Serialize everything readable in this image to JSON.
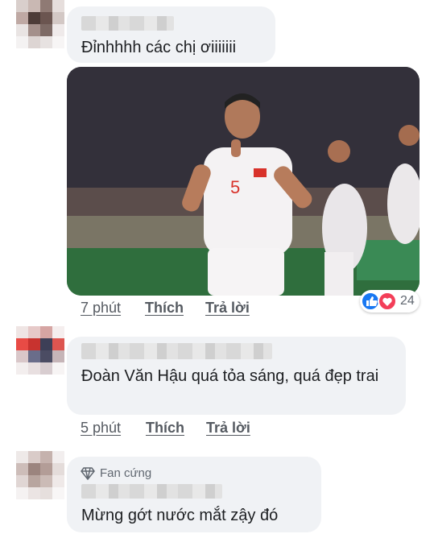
{
  "comments": [
    {
      "text": "Đỉnhhhh các chị ơiiiiiii",
      "time": "7 phút",
      "like": "Thích",
      "reply": "Trả lời",
      "reaction_count": "24"
    },
    {
      "text": "Đoàn Văn Hậu quá tỏa sáng, quá đẹp trai",
      "time": "5 phút",
      "like": "Thích",
      "reply": "Trả lời"
    },
    {
      "badge": "Fan cứng",
      "text": "Mừng gớt nước mắt zậy đó"
    }
  ],
  "photo": {
    "jersey_number": "5"
  },
  "colors": {
    "bubble": "#f0f2f5",
    "like_blue": "#1877f2",
    "love_red": "#f33e58",
    "pitch_green": "#2f6e3d"
  }
}
